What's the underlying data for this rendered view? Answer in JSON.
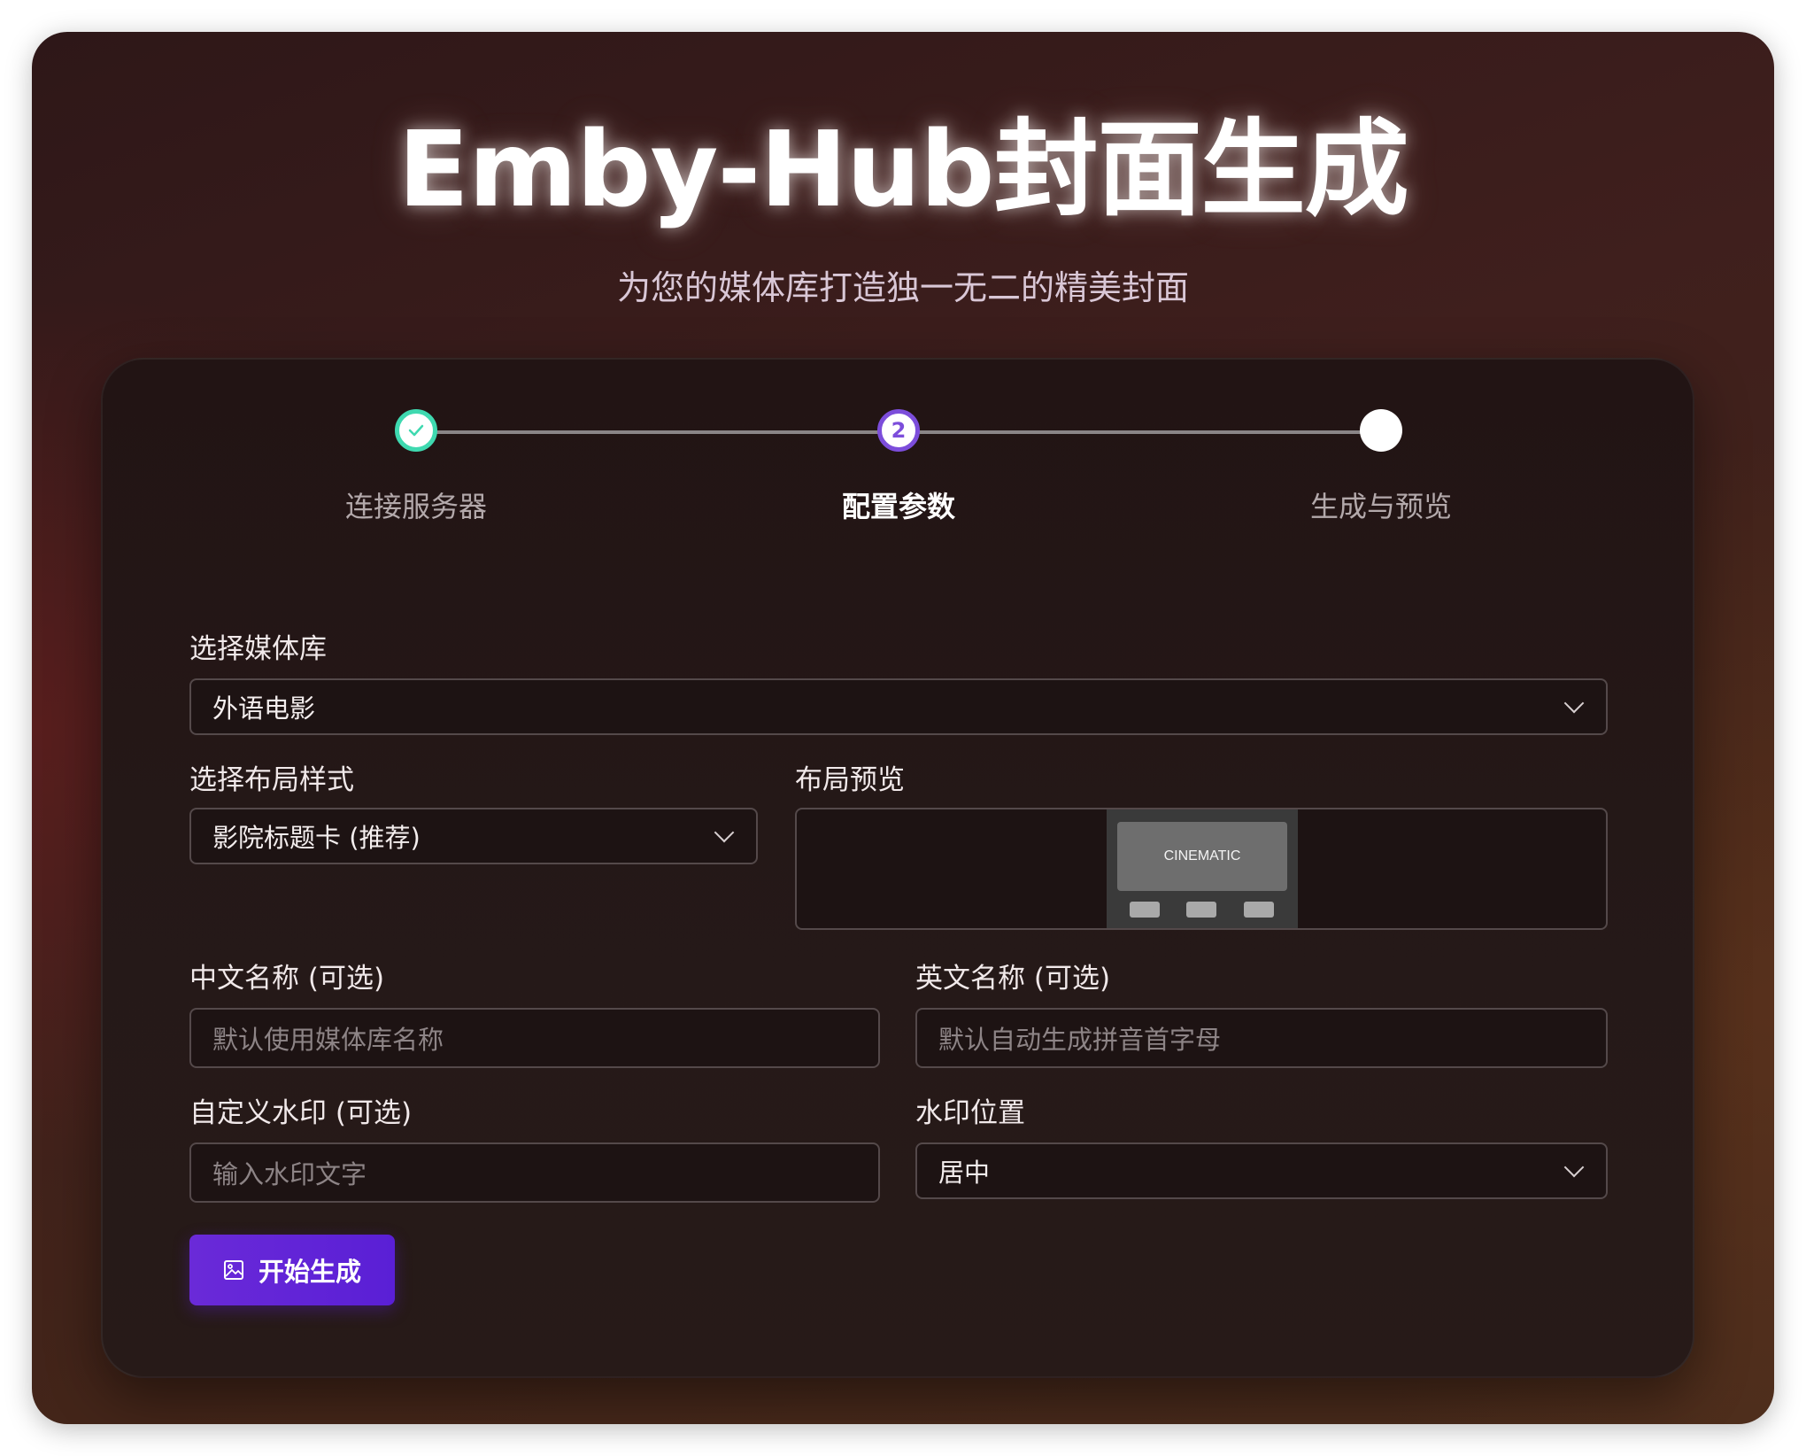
{
  "header": {
    "title": "Emby-Hub封面生成",
    "subtitle": "为您的媒体库打造独一无二的精美封面"
  },
  "stepper": {
    "steps": [
      {
        "label": "连接服务器",
        "state": "done"
      },
      {
        "label": "配置参数",
        "state": "active",
        "number": "2"
      },
      {
        "label": "生成与预览",
        "state": "todo"
      }
    ]
  },
  "form": {
    "library": {
      "label": "选择媒体库",
      "value": "外语电影"
    },
    "layout": {
      "label": "选择布局样式",
      "value": "影院标题卡 (推荐)"
    },
    "preview": {
      "label": "布局预览",
      "thumb_text": "CINEMATIC"
    },
    "cn_name": {
      "label": "中文名称 (可选)",
      "placeholder": "默认使用媒体库名称"
    },
    "en_name": {
      "label": "英文名称 (可选)",
      "placeholder": "默认自动生成拼音首字母"
    },
    "watermark": {
      "label": "自定义水印 (可选)",
      "placeholder": "输入水印文字"
    },
    "watermark_pos": {
      "label": "水印位置",
      "value": "居中"
    },
    "generate_button": "开始生成"
  },
  "colors": {
    "accent": "#6a2ad8",
    "done": "#3fd9b0",
    "active": "#7c4ddb"
  }
}
